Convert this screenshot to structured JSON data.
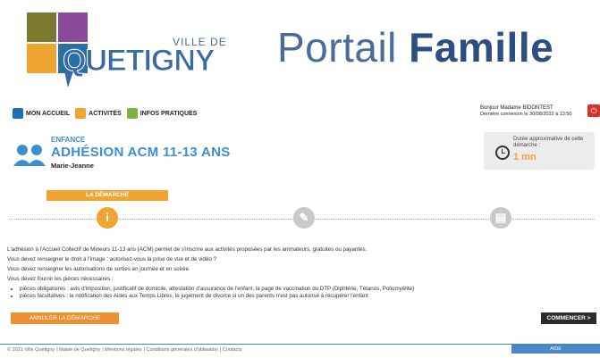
{
  "logo": {
    "ville": "VILLE DE",
    "name": "QUETIGNY"
  },
  "portal": {
    "word1": "Portail",
    "word2": "Famille"
  },
  "nav": {
    "items": [
      {
        "label": "MON ACCUEIL",
        "icon": "home-icon"
      },
      {
        "label": "ACTIVITÉS",
        "icon": "activities-icon"
      },
      {
        "label": "INFOS PRATIQUES",
        "icon": "info-icon"
      }
    ]
  },
  "user": {
    "greeting": "Bonjour Madame BIDONTEST",
    "last_login": "Dernière connexion le 30/08/2022 à 13:50"
  },
  "page": {
    "category": "ENFANCE",
    "title": "ADHÉSION ACM 11-13 ANS",
    "child": "Marie-Jeanne"
  },
  "duration": {
    "label": "Durée approximative de cette démarche :",
    "value": "1 mn"
  },
  "steps": {
    "current_label": "LA DÉMARCHE",
    "icons": [
      "info-icon",
      "pencil-icon",
      "document-icon"
    ],
    "current_index": 0
  },
  "content": {
    "p1": "L'adhésion à l'Accueil Collectif de Mineurs 11-13 ans (ACM) permet de s'inscrire aux activités proposées par les animateurs, gratuites ou payantes.",
    "p2": "Vous devez renseigner le droit à l'image : autorisez-vous la prise de vue et de vidéo ?",
    "p3": "Vous devez renseigner les autorisations de sorties en journée et en soirée.",
    "p4": "Vous devez fournir les pièces nécessaires :",
    "list": [
      "pièces obligatoires : avis d'imposition, justificatif de domicile, attestation d'assurance de l'enfant, la page de vaccination du DTP (Diphtérie, Tétanos, Poliomyélite)",
      "pièces facultatives : la notification des Aides aux Temps Libres, le jugement de divorce si un des parents n'est pas autorisé à récupérer l'enfant"
    ]
  },
  "buttons": {
    "cancel": "ANNULER LA DÉMARCHE",
    "start": "COMMENCER >"
  },
  "footer": {
    "copyright": "© 2021 Ville Quetigny",
    "links": [
      "Mairie de Quetigny",
      "Mentions légales",
      "Conditions générales d'utilisation",
      "Contacts"
    ],
    "help": "AIDE"
  },
  "colors": {
    "primary_blue": "#3b8fd0",
    "accent_orange": "#f0a532",
    "danger_red": "#d93025",
    "dark_button": "#2c2c2c"
  }
}
